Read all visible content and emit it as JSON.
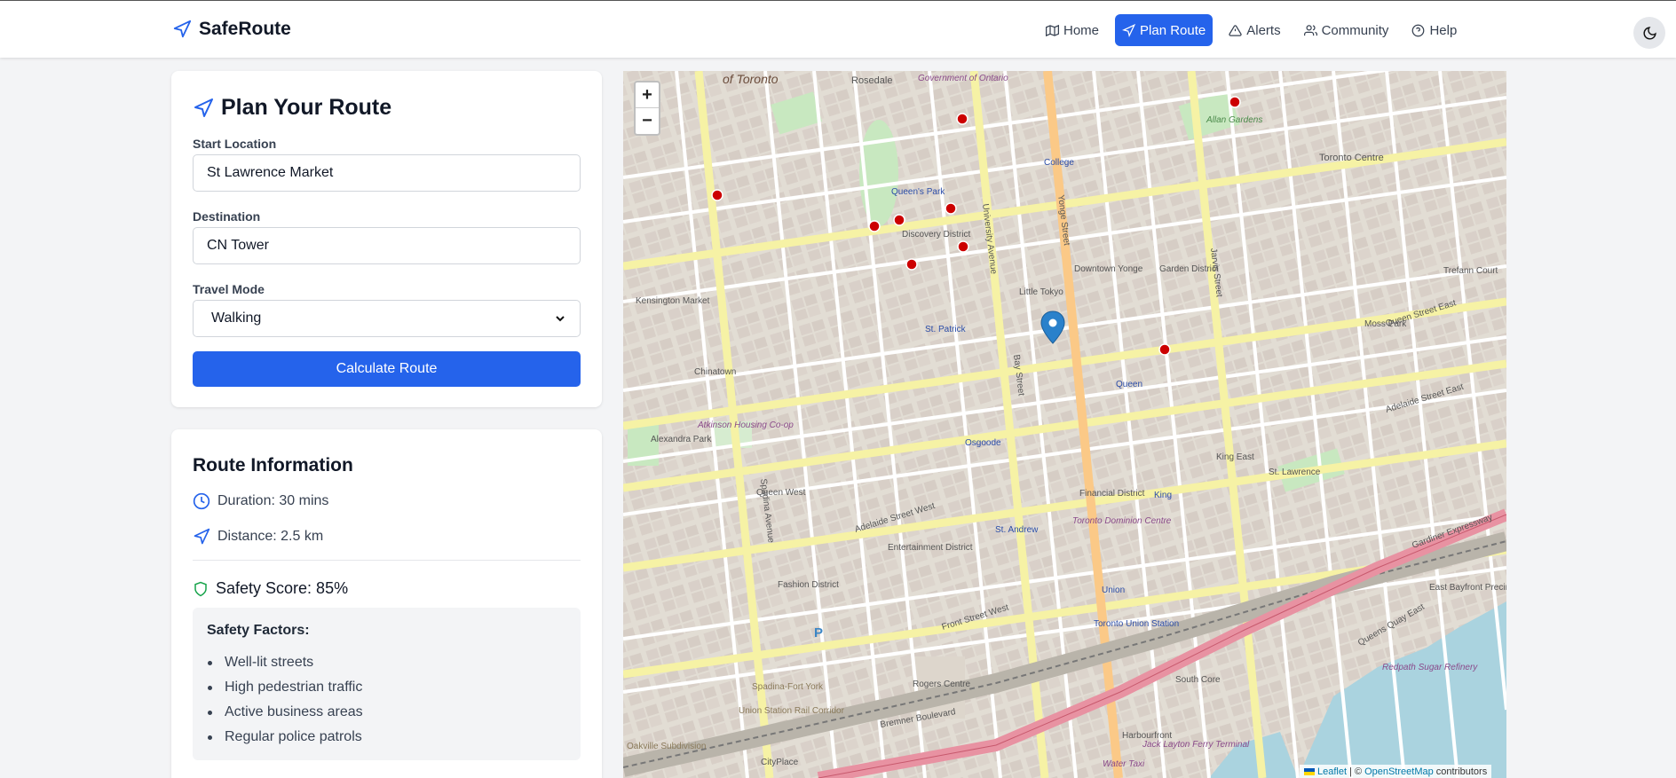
{
  "nav": {
    "brand": "SafeRoute",
    "links": [
      {
        "label": "Home",
        "icon": "map-icon"
      },
      {
        "label": "Plan Route",
        "icon": "navigation-icon",
        "active": true
      },
      {
        "label": "Alerts",
        "icon": "alert-triangle-icon"
      },
      {
        "label": "Community",
        "icon": "users-icon"
      },
      {
        "label": "Help",
        "icon": "help-circle-icon"
      }
    ],
    "theme_icon": "moon-icon"
  },
  "plan": {
    "title": "Plan Your Route",
    "start_label": "Start Location",
    "start_value": "St Lawrence Market",
    "dest_label": "Destination",
    "dest_value": "CN Tower",
    "mode_label": "Travel Mode",
    "mode_value": "Walking",
    "button": "Calculate Route"
  },
  "info": {
    "title": "Route Information",
    "duration": "Duration: 30 mins",
    "distance": "Distance: 2.5 km",
    "safety_score": "Safety Score: 85%",
    "factors_title": "Safety Factors:",
    "factors": [
      "Well-lit streets",
      "High pedestrian traffic",
      "Active business areas",
      "Regular police patrols"
    ]
  },
  "map": {
    "zoom_in": "+",
    "zoom_out": "−",
    "attribution_leaflet": "Leaflet",
    "attribution_sep": "| ©",
    "attribution_osm": "OpenStreetMap",
    "attribution_suffix": "contributors",
    "labels": [
      {
        "text": "of Toronto",
        "cls": "big"
      },
      {
        "text": "Rosedale"
      },
      {
        "text": "Government of Ontario",
        "cls": "purple"
      },
      {
        "text": "Queen's Park",
        "cls": "blue"
      },
      {
        "text": "College",
        "cls": "blue"
      },
      {
        "text": "Discovery District"
      },
      {
        "text": "Allan Gardens",
        "cls": "green"
      },
      {
        "text": "Toronto Centre"
      },
      {
        "text": "Kensington Market"
      },
      {
        "text": "Little Tokyo"
      },
      {
        "text": "Downtown Yonge"
      },
      {
        "text": "Garden District"
      },
      {
        "text": "Chinatown"
      },
      {
        "text": "St. Patrick",
        "cls": "blue"
      },
      {
        "text": "Queen",
        "cls": "blue"
      },
      {
        "text": "Moss Park"
      },
      {
        "text": "Alexandra Park"
      },
      {
        "text": "Atkinson Housing Co-op",
        "cls": "purple"
      },
      {
        "text": "Osgoode",
        "cls": "blue"
      },
      {
        "text": "Queen West"
      },
      {
        "text": "Financial District"
      },
      {
        "text": "King",
        "cls": "blue"
      },
      {
        "text": "King East"
      },
      {
        "text": "St. Lawrence"
      },
      {
        "text": "St. Andrew",
        "cls": "blue"
      },
      {
        "text": "Toronto Dominion Centre",
        "cls": "purple"
      },
      {
        "text": "Entertainment District"
      },
      {
        "text": "Fashion District"
      },
      {
        "text": "Union",
        "cls": "blue"
      },
      {
        "text": "Toronto Union Station",
        "cls": "blue"
      },
      {
        "text": "Front Street West"
      },
      {
        "text": "Adelaide Street West"
      },
      {
        "text": "Adelaide Street East"
      },
      {
        "text": "Queen Street East"
      },
      {
        "text": "Gardiner Expressway"
      },
      {
        "text": "Queens Quay East"
      },
      {
        "text": "East Bayfront Precinct"
      },
      {
        "text": "Redpath Sugar Refinery",
        "cls": "purple"
      },
      {
        "text": "South Core"
      },
      {
        "text": "Rogers Centre"
      },
      {
        "text": "Spadina-Fort York"
      },
      {
        "text": "Union Station Rail Corridor"
      },
      {
        "text": "Bremner Boulevard"
      },
      {
        "text": "Harbourfront"
      },
      {
        "text": "Jack Layton Ferry Terminal",
        "cls": "purple"
      },
      {
        "text": "Water Taxi",
        "cls": "purple"
      },
      {
        "text": "CityPlace"
      },
      {
        "text": "Oakville Subdivision"
      },
      {
        "text": "Trefann Court"
      },
      {
        "text": "Yonge Street"
      },
      {
        "text": "Jarvis Street"
      },
      {
        "text": "Spadina Avenue"
      },
      {
        "text": "University Avenue"
      },
      {
        "text": "Bay Street"
      }
    ]
  },
  "colors": {
    "primary": "#2563eb",
    "safety": "#16a34a",
    "major_road": "#f6f2a5",
    "highway": "#e892a2",
    "water": "#aad3df",
    "marker": "#2a81cb"
  }
}
